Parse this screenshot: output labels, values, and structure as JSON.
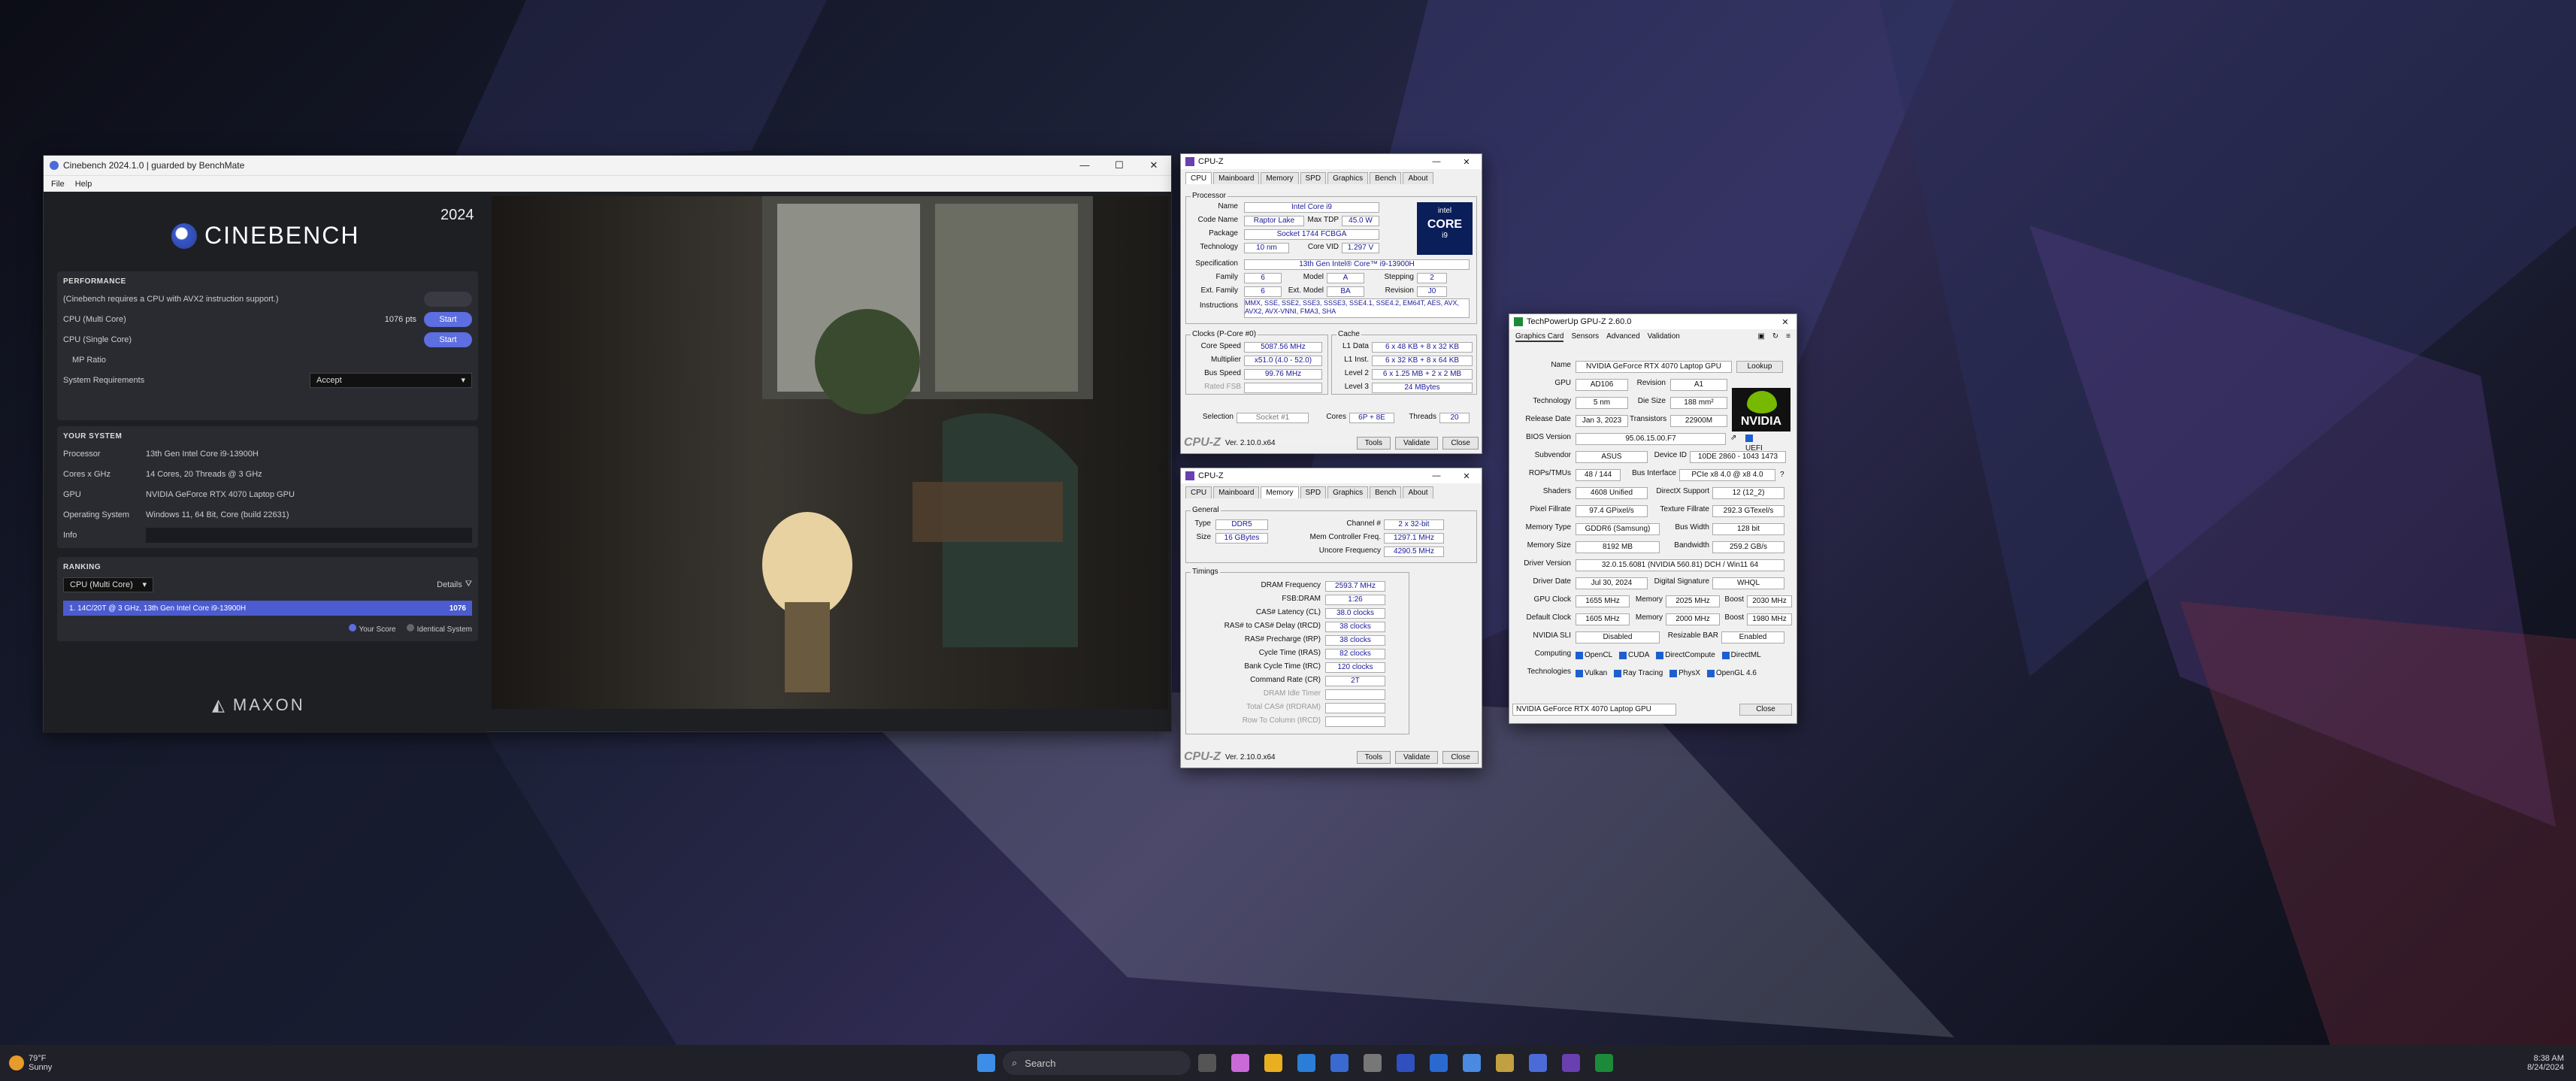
{
  "cinebench": {
    "title": "Cinebench 2024.1.0 | guarded by BenchMate",
    "menu": [
      "File",
      "Help"
    ],
    "brand": "CINEBENCH",
    "year": "2024",
    "performance": {
      "heading": "PERFORMANCE",
      "note": "(Cinebench requires a CPU with AVX2 instruction support.)",
      "multi_label": "CPU (Multi Core)",
      "multi_score": "1076 pts",
      "single_label": "CPU (Single Core)",
      "mp_label": "MP Ratio",
      "sysreq_label": "System Requirements",
      "sysreq_value": "Accept",
      "start": "Start"
    },
    "system": {
      "heading": "YOUR SYSTEM",
      "rows": [
        {
          "k": "Processor",
          "v": "13th Gen Intel Core i9-13900H"
        },
        {
          "k": "Cores x GHz",
          "v": "14 Cores, 20 Threads @ 3 GHz"
        },
        {
          "k": "GPU",
          "v": "NVIDIA GeForce RTX 4070 Laptop GPU"
        },
        {
          "k": "Operating System",
          "v": "Windows 11, 64 Bit, Core (build 22631)"
        },
        {
          "k": "Info",
          "v": ""
        }
      ]
    },
    "ranking": {
      "heading": "RANKING",
      "select": "CPU (Multi Core)",
      "details": "Details",
      "entry": "1. 14C/20T @ 3 GHz, 13th Gen Intel Core i9-13900H",
      "entry_score": "1076",
      "legend_your": "Your Score",
      "legend_identical": "Identical System"
    },
    "maxon": "MAXON"
  },
  "cpuz1": {
    "title": "CPU-Z",
    "tabs": [
      "CPU",
      "Mainboard",
      "Memory",
      "SPD",
      "Graphics",
      "Bench",
      "About"
    ],
    "processor_label": "Processor",
    "name": "Intel Core i9",
    "code_name": "Raptor Lake",
    "max_tdp": "45.0 W",
    "package": "Socket 1744 FCBGA",
    "technology": "10 nm",
    "core_vid": "1.297 V",
    "specification": "13th Gen Intel® Core™ i9-13900H",
    "family": "6",
    "model": "A",
    "stepping": "2",
    "ext_family": "6",
    "ext_model": "BA",
    "revision": "J0",
    "instructions": "MMX, SSE, SSE2, SSE3, SSSE3, SSE4.1, SSE4.2, EM64T, AES, AVX, AVX2, AVX-VNNI, FMA3, SHA",
    "clocks_label": "Clocks (P-Core #0)",
    "core_speed": "5087.56 MHz",
    "multiplier": "x51.0 (4.0 - 52.0)",
    "bus_speed": "99.76 MHz",
    "rated_fsb": "Rated FSB",
    "cache_label": "Cache",
    "l1d": "6 x 48 KB + 8 x 32 KB",
    "l1i": "6 x 32 KB + 8 x 64 KB",
    "l2": "6 x 1.25 MB + 2 x 2 MB",
    "l3": "24 MBytes",
    "selection": "Socket #1",
    "cores": "6P + 8E",
    "threads": "20",
    "version": "Ver. 2.10.0.x64",
    "tools": "Tools",
    "validate": "Validate",
    "close": "Close",
    "intel_badge": [
      "intel",
      "CORE",
      "i9"
    ]
  },
  "cpuz2": {
    "title": "CPU-Z",
    "general_label": "General",
    "type": "DDR5",
    "size": "16 GBytes",
    "channel": "2 x 32-bit",
    "mem_ctrl_freq": "1297.1 MHz",
    "uncore_freq": "4290.5 MHz",
    "timings_label": "Timings",
    "timings": [
      {
        "k": "DRAM Frequency",
        "v": "2593.7 MHz"
      },
      {
        "k": "FSB:DRAM",
        "v": "1:26"
      },
      {
        "k": "CAS# Latency (CL)",
        "v": "38.0 clocks"
      },
      {
        "k": "RAS# to CAS# Delay (tRCD)",
        "v": "38 clocks"
      },
      {
        "k": "RAS# Precharge (tRP)",
        "v": "38 clocks"
      },
      {
        "k": "Cycle Time (tRAS)",
        "v": "82 clocks"
      },
      {
        "k": "Bank Cycle Time (tRC)",
        "v": "120 clocks"
      },
      {
        "k": "Command Rate (CR)",
        "v": "2T"
      },
      {
        "k": "DRAM Idle Timer",
        "v": ""
      },
      {
        "k": "Total CAS# (tRDRAM)",
        "v": ""
      },
      {
        "k": "Row To Column (tRCD)",
        "v": ""
      }
    ]
  },
  "gpuz": {
    "title": "TechPowerUp GPU-Z 2.60.0",
    "tabs": [
      "Graphics Card",
      "Sensors",
      "Advanced",
      "Validation"
    ],
    "name": "NVIDIA GeForce RTX 4070 Laptop GPU",
    "lookup": "Lookup",
    "gpu": "AD106",
    "revision": "A1",
    "technology": "5 nm",
    "die_size": "188 mm²",
    "release_date": "Jan 3, 2023",
    "transistors": "22900M",
    "bios": "95.06.15.00.F7",
    "uefi": "UEFI",
    "subvendor": "ASUS",
    "device_id": "10DE 2860 - 1043 1473",
    "rops": "48 / 144",
    "bus_interface": "PCIe x8 4.0 @ x8 4.0",
    "shaders": "4608 Unified",
    "directx": "12 (12_2)",
    "pixel_fill": "97.4 GPixel/s",
    "texture_fill": "292.3 GTexel/s",
    "mem_type": "GDDR6 (Samsung)",
    "bus_width": "128 bit",
    "mem_size": "8192 MB",
    "bandwidth": "259.2 GB/s",
    "driver": "32.0.15.6081 (NVIDIA 560.81) DCH / Win11 64",
    "driver_date": "Jul 30, 2024",
    "signature": "WHQL",
    "gpu_clock": "1655 MHz",
    "memory_clock": "2025 MHz",
    "boost": "2030 MHz",
    "def_clock": "1605 MHz",
    "def_memory": "2000 MHz",
    "def_boost": "1980 MHz",
    "sli": "Disabled",
    "resizable_bar": "Enabled",
    "computing": [
      "OpenCL",
      "CUDA",
      "DirectCompute",
      "DirectML"
    ],
    "technologies": [
      "Vulkan",
      "Ray Tracing",
      "PhysX",
      "OpenGL 4.6"
    ],
    "selected_gpu": "NVIDIA GeForce RTX 4070 Laptop GPU",
    "close": "Close",
    "nvidia": "NVIDIA"
  },
  "taskbar": {
    "weather_temp": "79°F",
    "weather_cond": "Sunny",
    "search": "Search",
    "time": "8:38 AM",
    "date": "8/24/2024"
  }
}
